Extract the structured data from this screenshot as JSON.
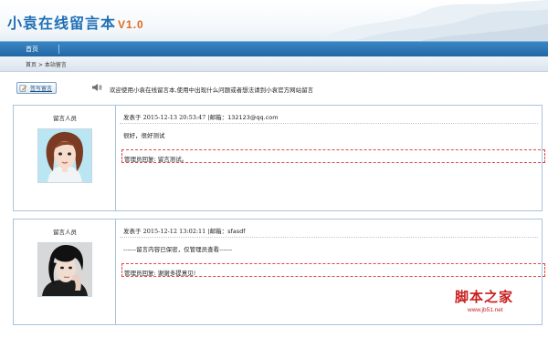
{
  "site": {
    "title": "小袁在线留言本",
    "version": "V1.0"
  },
  "nav": {
    "items": [
      {
        "label": "首页"
      }
    ]
  },
  "breadcrumb": {
    "text": "首页 > 本站留言"
  },
  "toolbar": {
    "write_label": "签写留言",
    "notice": "欢迎使用小袁在线留言本,使用中出现什么问题或者想法请到小袁官方网站留言"
  },
  "messages": [
    {
      "role": "留言人员",
      "posted_prefix": "发表于 ",
      "time": "2015-12-13 20:53:47",
      "email_part": " |邮箱：132123@qq.com",
      "content": "很好，很好测试",
      "reply": "管理员回复: 留言测试。"
    },
    {
      "role": "留言人员",
      "posted_prefix": "发表于 ",
      "time": "2015-12-12 13:02:11",
      "email_part": " |邮箱：sfasdf",
      "content": "------留言内容已保密，仅管理员查看------",
      "reply": "管理员回复: 谢谢多提意见!"
    }
  ],
  "watermark": {
    "title": "脚本之家",
    "url": "www.jb51.net"
  },
  "colors": {
    "brand_blue": "#1f6fb5",
    "nav_blue": "#2167a4",
    "version_orange": "#e06a1c",
    "reply_border": "#e24545",
    "watermark_red": "#c91f1f"
  }
}
